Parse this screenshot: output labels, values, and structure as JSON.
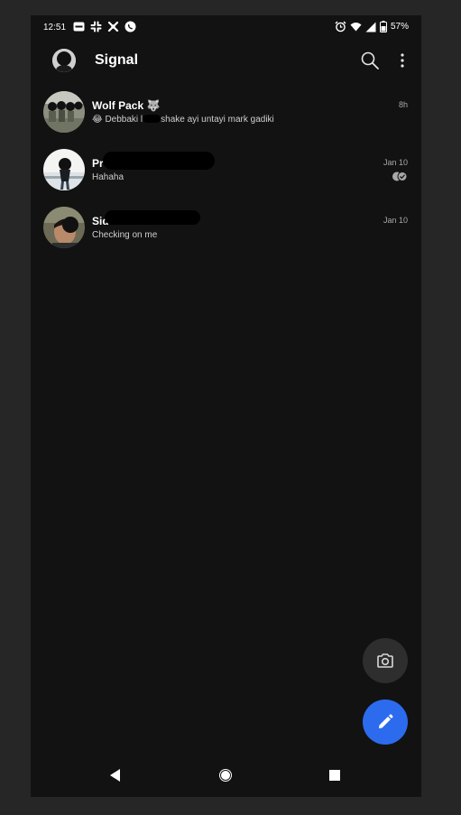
{
  "status_bar": {
    "time": "12:51",
    "battery": "57%",
    "icons": [
      "airtel-icon",
      "slack-icon",
      "settings-app-icon",
      "whatsapp-icon",
      "alarm-icon",
      "wifi-icon",
      "signal-strength-icon",
      "battery-icon"
    ]
  },
  "app_bar": {
    "title": "Signal",
    "icons": [
      "profile-avatar",
      "search-icon",
      "overflow-menu-icon"
    ]
  },
  "conversations": [
    {
      "name": "Wolf Pack 🐺",
      "snippet": "😂 Debbaki l",
      "snippet_tail": "shake ayi untayi mark gadiki",
      "date": "8h"
    },
    {
      "name": "Pr",
      "snippet": "Hahaha",
      "date": "Jan 10",
      "status_icon": "delivered-check-icon"
    },
    {
      "name": "Sid",
      "snippet": "Checking on me",
      "date": "Jan 10"
    }
  ],
  "fabs": {
    "camera_icon": "camera-icon",
    "compose_icon": "pencil-icon",
    "compose_color": "#2c6bed"
  },
  "nav_bar": {
    "icons": [
      "back-icon",
      "home-icon",
      "recents-icon"
    ]
  }
}
